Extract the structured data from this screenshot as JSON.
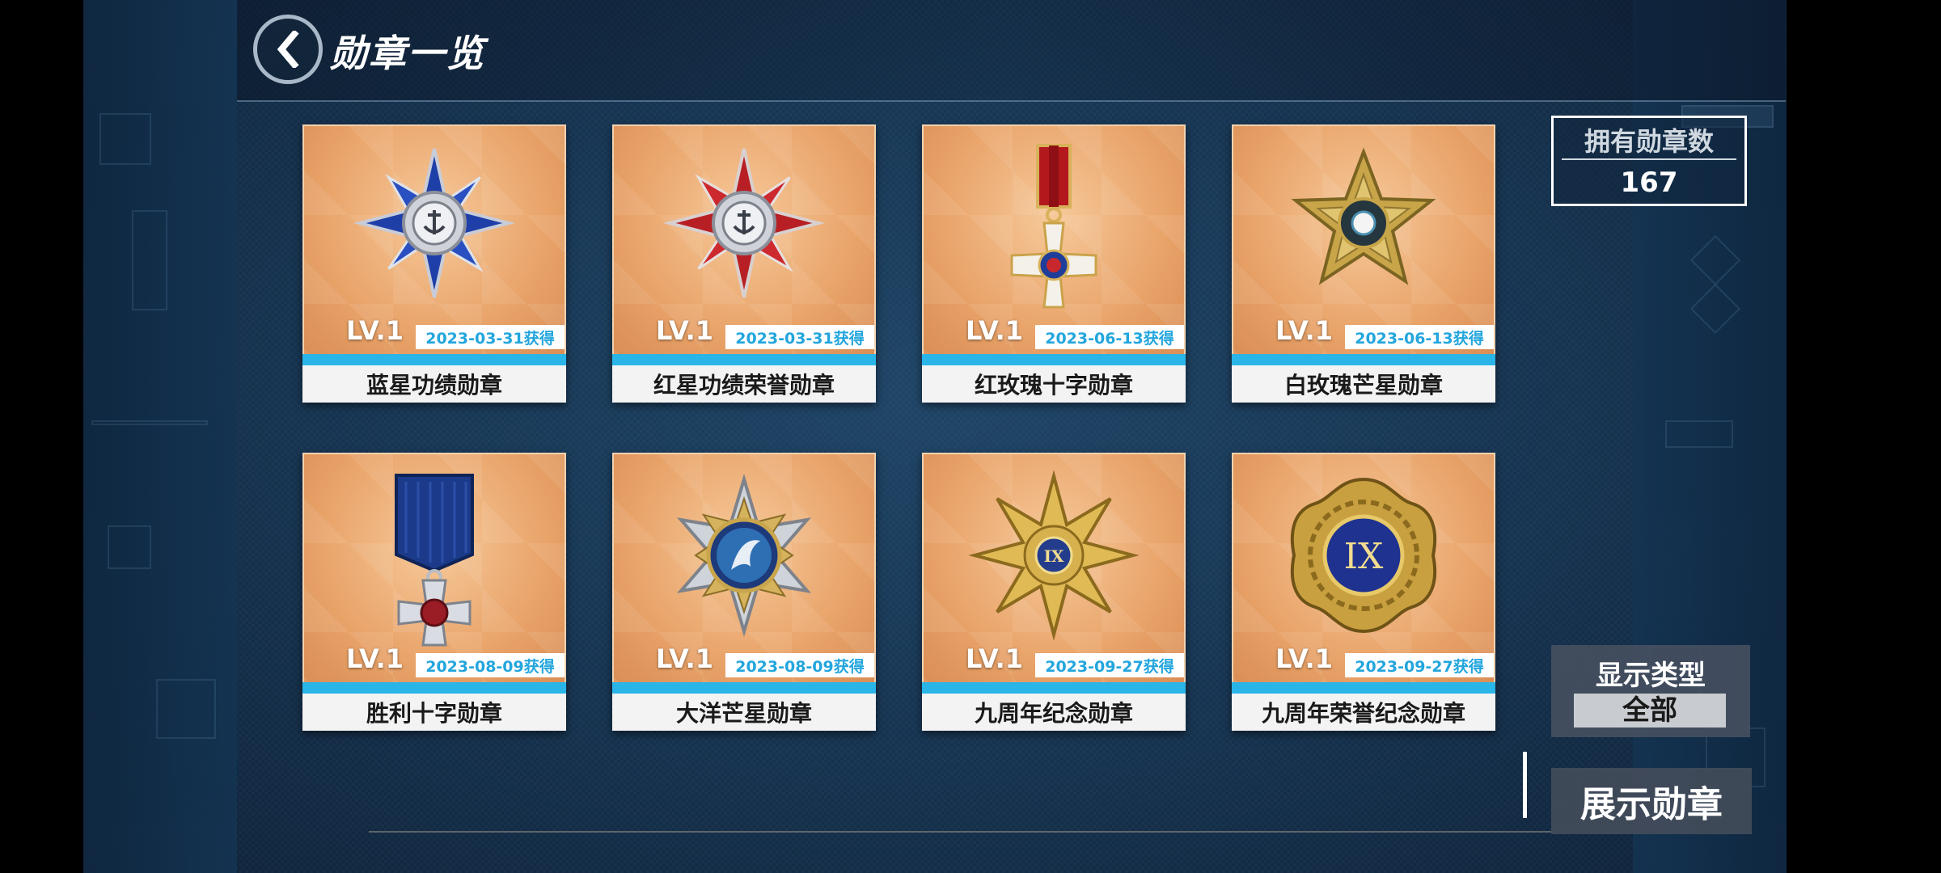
{
  "header": {
    "title": "勋章一览"
  },
  "medals": [
    {
      "level": "LV.1",
      "date": "2023-03-31获得",
      "name": "蓝星功绩勋章",
      "icon": "blue-star-medal-icon"
    },
    {
      "level": "LV.1",
      "date": "2023-03-31获得",
      "name": "红星功绩荣誉勋章",
      "icon": "red-star-medal-icon"
    },
    {
      "level": "LV.1",
      "date": "2023-06-13获得",
      "name": "红玫瑰十字勋章",
      "icon": "red-rose-cross-medal-icon"
    },
    {
      "level": "LV.1",
      "date": "2023-06-13获得",
      "name": "白玫瑰芒星勋章",
      "icon": "white-rose-star-medal-icon"
    },
    {
      "level": "LV.1",
      "date": "2023-08-09获得",
      "name": "胜利十字勋章",
      "icon": "victory-cross-medal-icon"
    },
    {
      "level": "LV.1",
      "date": "2023-08-09获得",
      "name": "大洋芒星勋章",
      "icon": "ocean-star-medal-icon"
    },
    {
      "level": "LV.1",
      "date": "2023-09-27获得",
      "name": "九周年纪念勋章",
      "icon": "ninth-anniversary-medal-icon"
    },
    {
      "level": "LV.1",
      "date": "2023-09-27获得",
      "name": "九周年荣誉纪念勋章",
      "icon": "ninth-anniversary-honor-medal-icon"
    }
  ],
  "owned": {
    "label": "拥有勋章数",
    "count": "167"
  },
  "filter": {
    "label": "显示类型",
    "selected": "全部"
  },
  "show_button": "展示勋章",
  "colors": {
    "accent": "#29b5e8",
    "card_bg": "#e9a46a",
    "background": "#173654"
  }
}
